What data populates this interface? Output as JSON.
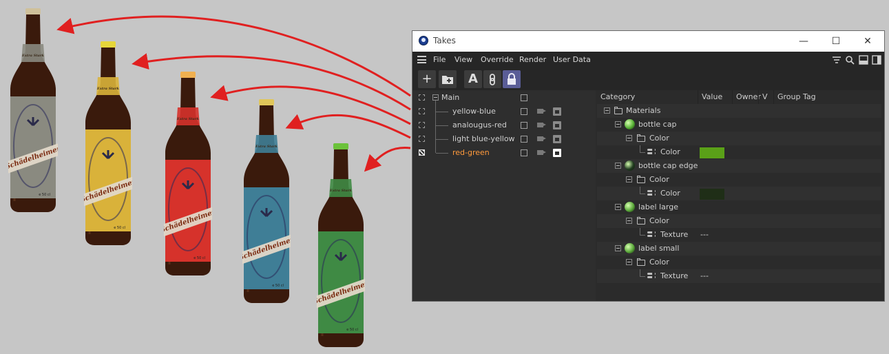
{
  "bottles": {
    "brand": "Schädelheimer",
    "subtitle": "Extra Stark",
    "volume": "e 50 cl",
    "variants": [
      {
        "label_color": "#8a8a80",
        "cap_color": "#cfc09a"
      },
      {
        "label_color": "#d9b23a",
        "cap_color": "#e6d63a"
      },
      {
        "label_color": "#d6322b",
        "cap_color": "#f0b050"
      },
      {
        "label_color": "#3f7e96",
        "cap_color": "#e0c65a"
      },
      {
        "label_color": "#3f8a44",
        "cap_color": "#6bc23a"
      }
    ]
  },
  "window": {
    "title": "Takes",
    "controls": {
      "minimize": "—",
      "maximize": "☐",
      "close": "✕"
    }
  },
  "menu": {
    "items": [
      "File",
      "View",
      "Override",
      "Render",
      "User Data"
    ]
  },
  "toolbar": {
    "add": "+",
    "add_folder": "+",
    "auto_take": "A",
    "link": "⌽",
    "lock": "🔒"
  },
  "takes": {
    "root": "Main",
    "items": [
      {
        "name": "yellow-blue",
        "active": false
      },
      {
        "name": "analougus-red",
        "active": false
      },
      {
        "name": "light blue-yellow",
        "active": false
      },
      {
        "name": "red-green",
        "active": true
      }
    ],
    "active_color": "#ff9a3c"
  },
  "columns": [
    "Category",
    "Value",
    "Owner",
    "V",
    "Group Tag"
  ],
  "overrides": {
    "root": "Materials",
    "materials": [
      {
        "name": "bottle cap",
        "swatch": "#56b034",
        "group": "Color",
        "param": "Color",
        "value": "",
        "value_color": "#5aa018"
      },
      {
        "name": "bottle cap edge",
        "swatch": "#1f3a1f",
        "group": "Color",
        "param": "Color",
        "value": "",
        "value_color": "#1f2e17"
      },
      {
        "name": "label large",
        "swatch": "#5aa83a",
        "group": "Color",
        "param": "Texture",
        "value": "---",
        "value_color": ""
      },
      {
        "name": "label small",
        "swatch": "#5aa83a",
        "group": "Color",
        "param": "Texture",
        "value": "---",
        "value_color": ""
      }
    ]
  },
  "arrow_color": "#e02020"
}
